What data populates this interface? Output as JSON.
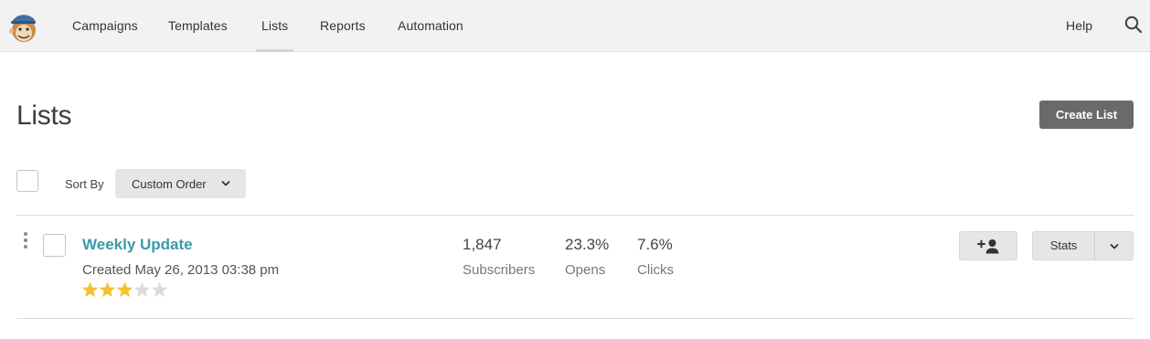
{
  "nav": {
    "items": [
      {
        "label": "Campaigns",
        "active": false
      },
      {
        "label": "Templates",
        "active": false
      },
      {
        "label": "Lists",
        "active": true
      },
      {
        "label": "Reports",
        "active": false
      },
      {
        "label": "Automation",
        "active": false
      }
    ],
    "help_label": "Help",
    "logo_icon": "freddie-monkey-logo",
    "search_icon": "search-icon"
  },
  "page": {
    "title": "Lists",
    "create_button_label": "Create List"
  },
  "sort": {
    "label": "Sort By",
    "selected": "Custom Order"
  },
  "lists": [
    {
      "name": "Weekly Update",
      "created": "Created May 26, 2013 03:38 pm",
      "rating": 3,
      "rating_max": 5,
      "stats": [
        {
          "value": "1,847",
          "label": "Subscribers"
        },
        {
          "value": "23.3%",
          "label": "Opens"
        },
        {
          "value": "7.6%",
          "label": "Clicks"
        }
      ],
      "stats_button_label": "Stats"
    }
  ],
  "colors": {
    "accent_link": "#3a9aa8",
    "star_filled": "#f2c230",
    "star_empty": "#dcdcdc",
    "primary_button": "#6a6a6a"
  }
}
